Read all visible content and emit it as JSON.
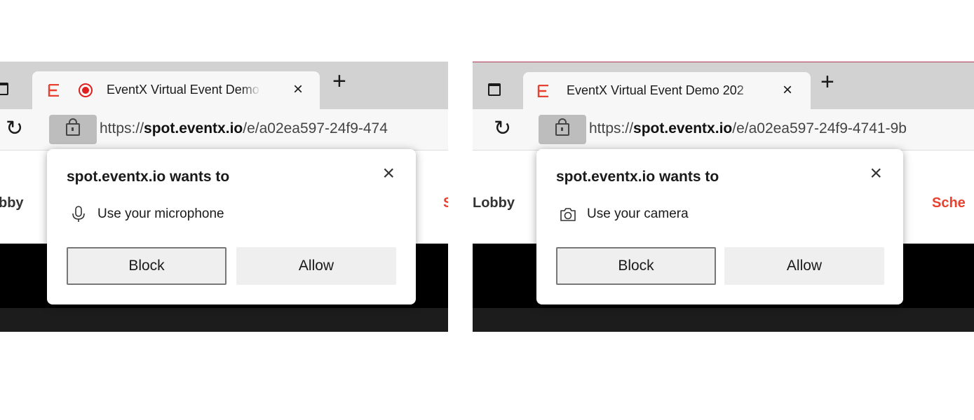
{
  "left": {
    "tab_title": "EventX Virtual Event Demo",
    "tab_close": "×",
    "new_tab": "+",
    "reload": "↻",
    "url_scheme": "https://",
    "url_host": "spot.eventx.io",
    "url_path": "/e/a02ea597-24f9-474",
    "nav_lobby": "bby",
    "nav_sched": "S",
    "prompt": {
      "title": "spot.eventx.io wants to",
      "close": "×",
      "permission": "Use your microphone",
      "permission_icon": "microphone-icon",
      "block_label": "Block",
      "allow_label": "Allow"
    }
  },
  "right": {
    "tab_title": "EventX Virtual Event Demo 202",
    "tab_close": "×",
    "new_tab": "+",
    "reload": "↻",
    "url_scheme": "https://",
    "url_host": "spot.eventx.io",
    "url_path": "/e/a02ea597-24f9-4741-9b",
    "nav_lobby": "Lobby",
    "nav_sched": "Sche",
    "prompt": {
      "title": "spot.eventx.io wants to",
      "close": "×",
      "permission": "Use your camera",
      "permission_icon": "camera-icon",
      "block_label": "Block",
      "allow_label": "Allow"
    }
  },
  "colors": {
    "accent_red": "#e8412f",
    "recording_red": "#e02020",
    "tabstrip": "#d2d2d2",
    "toolbar": "#f7f7f7"
  }
}
